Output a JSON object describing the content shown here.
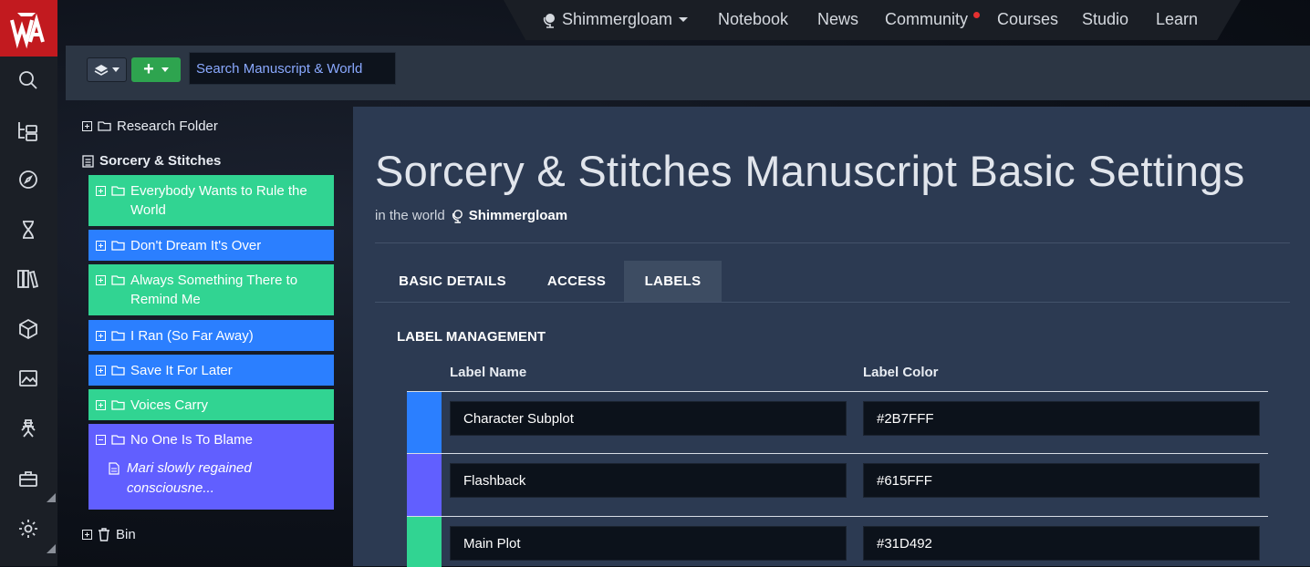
{
  "colors": {
    "green": "#31d492",
    "blue": "#2b7fff",
    "purple": "#615fff",
    "brand": "#c21a1f"
  },
  "rail": {
    "icons": [
      "search-icon",
      "tree-icon",
      "compass-icon",
      "hourglass-icon",
      "books-icon",
      "cube-icon",
      "image-icon",
      "character-icon",
      "toolbox-icon",
      "gear-icon"
    ]
  },
  "nav": {
    "world": "Shimmergloam",
    "items": [
      "Notebook",
      "News",
      "Community",
      "Courses",
      "Studio",
      "Learn"
    ]
  },
  "toolbar": {
    "search_placeholder": "Search Manuscript & World",
    "add_label": "+"
  },
  "sidebar": {
    "research_folder": "Research Folder",
    "manuscript": "Sorcery & Stitches",
    "chapters": [
      {
        "label": "Everybody Wants to Rule the World",
        "color": "green"
      },
      {
        "label": "Don't Dream It's Over",
        "color": "blue"
      },
      {
        "label": "Always Something There to Remind Me",
        "color": "green"
      },
      {
        "label": "I Ran (So Far Away)",
        "color": "blue"
      },
      {
        "label": "Save It For Later",
        "color": "blue"
      },
      {
        "label": "Voices Carry",
        "color": "green"
      },
      {
        "label": "No One Is To Blame",
        "color": "purple",
        "child": "Mari slowly regained consciousne..."
      }
    ],
    "bin": "Bin"
  },
  "main": {
    "title": "Sorcery & Stitches Manuscript Basic Settings",
    "in_world_prefix": "in the world",
    "world_name": "Shimmergloam",
    "tabs": [
      "BASIC DETAILS",
      "ACCESS",
      "LABELS"
    ],
    "active_tab": "LABELS",
    "section_title": "LABEL MANAGEMENT",
    "columns": {
      "name": "Label Name",
      "color": "Label Color"
    },
    "labels": [
      {
        "name": "Character Subplot",
        "color": "#2B7FFF"
      },
      {
        "name": "Flashback",
        "color": "#615FFF"
      },
      {
        "name": "Main Plot",
        "color": "#31D492"
      }
    ]
  }
}
